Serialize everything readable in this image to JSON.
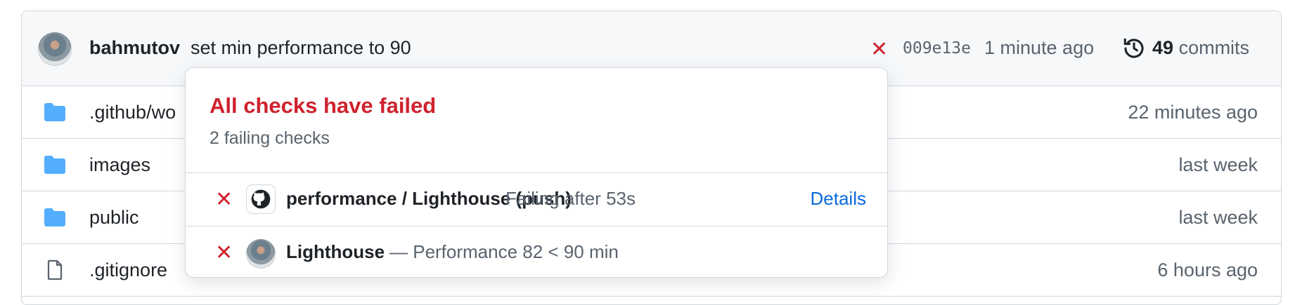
{
  "commit": {
    "author": "bahmutov",
    "message": "set min performance to 90",
    "status_icon": "x-icon",
    "sha": "009e13e",
    "time": "1 minute ago",
    "commits_count": "49",
    "commits_label": "commits"
  },
  "files": [
    {
      "name": ".github/wo",
      "type": "folder",
      "age": "22 minutes ago"
    },
    {
      "name": "images",
      "type": "folder",
      "age": "last week"
    },
    {
      "name": "public",
      "type": "folder",
      "age": "last week"
    },
    {
      "name": ".gitignore",
      "type": "file",
      "age": "6 hours ago"
    }
  ],
  "popup": {
    "title": "All checks have failed",
    "subtitle": "2 failing checks",
    "checks": [
      {
        "name": "performance / Lighthouse (push)",
        "desc": "Failing after 53s",
        "details": "Details"
      },
      {
        "name": "Lighthouse",
        "desc": "— Performance 82 < 90 min"
      }
    ]
  },
  "colors": {
    "fail_red": "#cf222e",
    "link_blue": "#0969da",
    "folder_blue": "#54aeff",
    "muted_text": "#59636e"
  }
}
